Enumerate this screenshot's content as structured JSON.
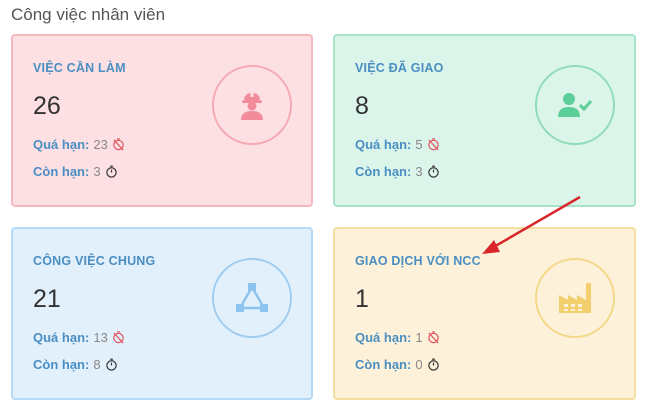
{
  "section": {
    "title": "Công việc nhân viên"
  },
  "cards": [
    {
      "title": "VIỆC CẦN LÀM",
      "count": "26",
      "overdue_label": "Quá hạn:",
      "overdue_value": "23",
      "remaining_label": "Còn hạn:",
      "remaining_value": "3",
      "icon": "worker-icon",
      "accent": "#f28b9a"
    },
    {
      "title": "VIỆC ĐÃ GIAO",
      "count": "8",
      "overdue_label": "Quá hạn:",
      "overdue_value": "5",
      "remaining_label": "Còn hạn:",
      "remaining_value": "3",
      "icon": "user-check-icon",
      "accent": "#5ccf98"
    },
    {
      "title": "CÔNG VIỆC CHUNG",
      "count": "21",
      "overdue_label": "Quá hạn:",
      "overdue_value": "13",
      "remaining_label": "Còn hạn:",
      "remaining_value": "8",
      "icon": "network-icon",
      "accent": "#8cc3ef"
    },
    {
      "title": "GIAO DỊCH VỚI NCC",
      "count": "1",
      "overdue_label": "Quá hạn:",
      "overdue_value": "1",
      "remaining_label": "Còn hạn:",
      "remaining_value": "0",
      "icon": "factory-icon",
      "accent": "#f3cf6f"
    }
  ],
  "colors": {
    "title_blue": "#4a8ec2",
    "overdue_red": "#e0525f",
    "arrow_red": "#d9262b"
  }
}
